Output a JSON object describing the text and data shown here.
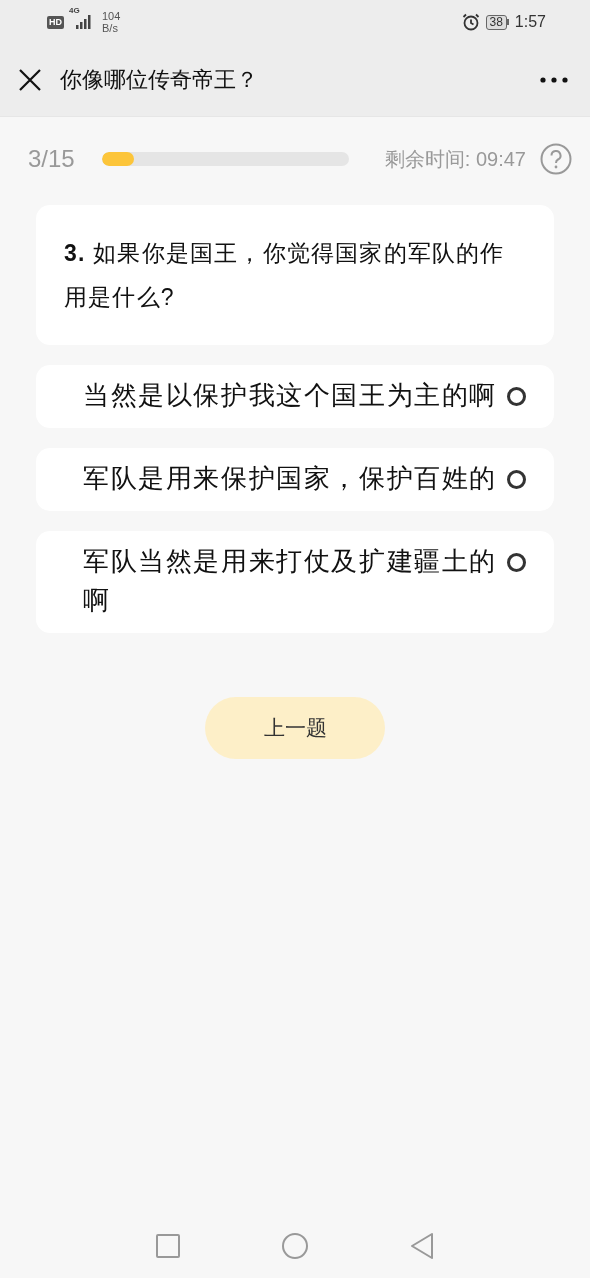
{
  "status_bar": {
    "badge": "HD",
    "network_type": "4G",
    "speed_value": "104",
    "speed_unit": "B/s",
    "battery": "38",
    "time": "1:57"
  },
  "header": {
    "title": "你像哪位传奇帝王？"
  },
  "progress": {
    "counter": "3/15",
    "level": 0.13,
    "timer": "剩余时间: 09:47"
  },
  "question": {
    "number": "3.",
    "text": "如果你是国王，你觉得国家的军队的作用是什么?"
  },
  "options": [
    {
      "label": "当然是以保护我这个国王为主的啊",
      "selected": false
    },
    {
      "label": "军队是用来保护国家，保护百姓的",
      "selected": false
    },
    {
      "label": "军队当然是用来打仗及扩建疆土的啊",
      "selected": false
    }
  ],
  "buttons": {
    "previous": "上一题"
  }
}
